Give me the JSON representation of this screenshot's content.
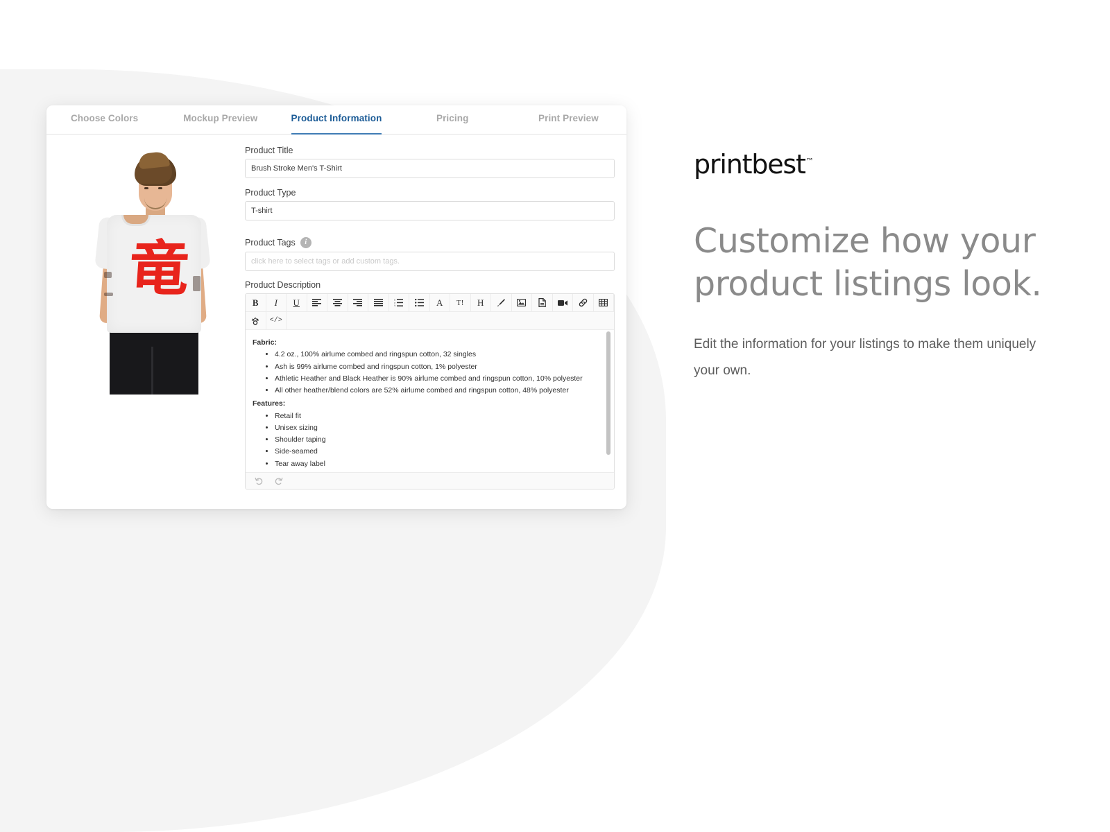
{
  "tabs": [
    {
      "label": "Choose Colors",
      "active": false
    },
    {
      "label": "Mockup Preview",
      "active": false
    },
    {
      "label": "Product Information",
      "active": true
    },
    {
      "label": "Pricing",
      "active": false
    },
    {
      "label": "Print Preview",
      "active": false
    }
  ],
  "mockup": {
    "artwork_glyph": "竜",
    "artwork_color": "#e8241c",
    "shirt_color": "#f1f1f1",
    "alt": "Male model wearing ash t-shirt with red brush stroke design"
  },
  "form": {
    "product_title": {
      "label": "Product Title",
      "value": "Brush Stroke Men's T-Shirt"
    },
    "product_type": {
      "label": "Product Type",
      "value": "T-shirt"
    },
    "product_tags": {
      "label": "Product Tags",
      "value": "",
      "placeholder": "click here to select tags or add custom tags.",
      "info_icon": "info-icon",
      "info_glyph": "i"
    },
    "product_description": {
      "label": "Product Description"
    }
  },
  "editor": {
    "toolbar_row1": [
      {
        "name": "bold",
        "glyph": "B"
      },
      {
        "name": "italic",
        "glyph": "I"
      },
      {
        "name": "underline",
        "glyph": "U"
      },
      {
        "name": "align-left",
        "glyph": ""
      },
      {
        "name": "align-center",
        "glyph": ""
      },
      {
        "name": "align-right",
        "glyph": ""
      },
      {
        "name": "align-justify",
        "glyph": ""
      },
      {
        "name": "ordered-list",
        "glyph": ""
      },
      {
        "name": "unordered-list",
        "glyph": ""
      },
      {
        "name": "font-family",
        "glyph": "A"
      },
      {
        "name": "font-size",
        "glyph": "T!"
      },
      {
        "name": "heading",
        "glyph": "H"
      },
      {
        "name": "brush-color",
        "glyph": ""
      },
      {
        "name": "insert-image",
        "glyph": ""
      },
      {
        "name": "insert-file",
        "glyph": ""
      },
      {
        "name": "insert-video",
        "glyph": ""
      },
      {
        "name": "insert-link",
        "glyph": ""
      },
      {
        "name": "insert-table",
        "glyph": ""
      }
    ],
    "toolbar_row2": [
      {
        "name": "clear-formatting",
        "glyph": ""
      },
      {
        "name": "code-view",
        "glyph": "</>"
      }
    ],
    "footer": [
      {
        "name": "undo",
        "glyph": "↺"
      },
      {
        "name": "redo",
        "glyph": "↻"
      }
    ],
    "content": {
      "sections": [
        {
          "heading": "Fabric:",
          "items": [
            "4.2 oz., 100% airlume combed and ringspun cotton, 32 singles",
            "Ash is 99% airlume combed and ringspun cotton, 1% polyester",
            "Athletic Heather and Black Heather is 90% airlume combed and ringspun cotton, 10% polyester",
            "All other heather/blend colors are 52% airlume combed and ringspun cotton, 48% polyester"
          ]
        },
        {
          "heading": "Features:",
          "items": [
            "Retail fit",
            "Unisex sizing",
            "Shoulder taping",
            "Side-seamed",
            "Tear away label"
          ]
        }
      ]
    }
  },
  "marketing": {
    "brand": "printbest",
    "brand_mark": "™",
    "heading": "Customize how your product listings look.",
    "subtext": "Edit the information for your listings to make them uniquely your own."
  },
  "colors": {
    "active_tab_text": "#1b5b96",
    "active_tab_underline": "#3f7cb5",
    "inactive_tab_text": "#a8a8a8",
    "backdrop": "#f4f4f4",
    "heading_gray": "#8a8a8a",
    "artwork_red": "#e8241c"
  }
}
